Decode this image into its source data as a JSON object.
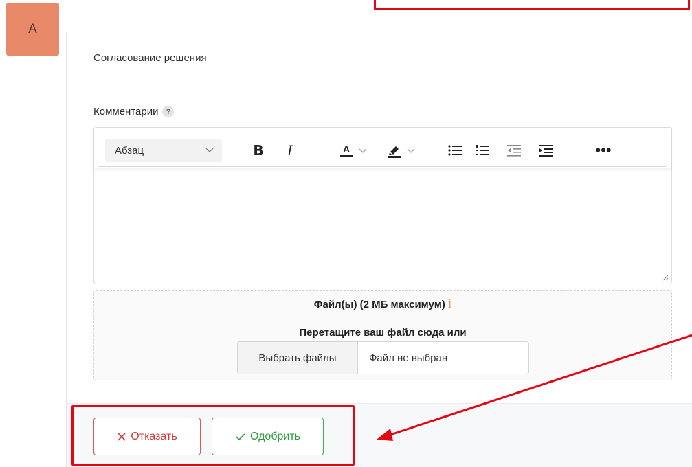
{
  "user": {
    "avatar_letter": "A",
    "avatar_color": "#e8896a"
  },
  "card": {
    "title": "Согласование решения"
  },
  "comments": {
    "label": "Комментарии",
    "help": "?"
  },
  "toolbar": {
    "block_format": "Абзац",
    "bold": "B",
    "italic": "I",
    "font_color": "A",
    "more": "•••"
  },
  "upload": {
    "title": "Файл(ы) (2 МБ максимум)",
    "info": "i",
    "hint": "Перетащите ваш файл сюда или",
    "choose_label": "Выбрать файлы",
    "status": "Файл не выбран"
  },
  "actions": {
    "reject_label": "Отказать",
    "approve_label": "Одобрить",
    "reject_color": "#d33a3a",
    "approve_color": "#2f9e3f"
  },
  "annotation": {
    "color": "#e30613"
  }
}
